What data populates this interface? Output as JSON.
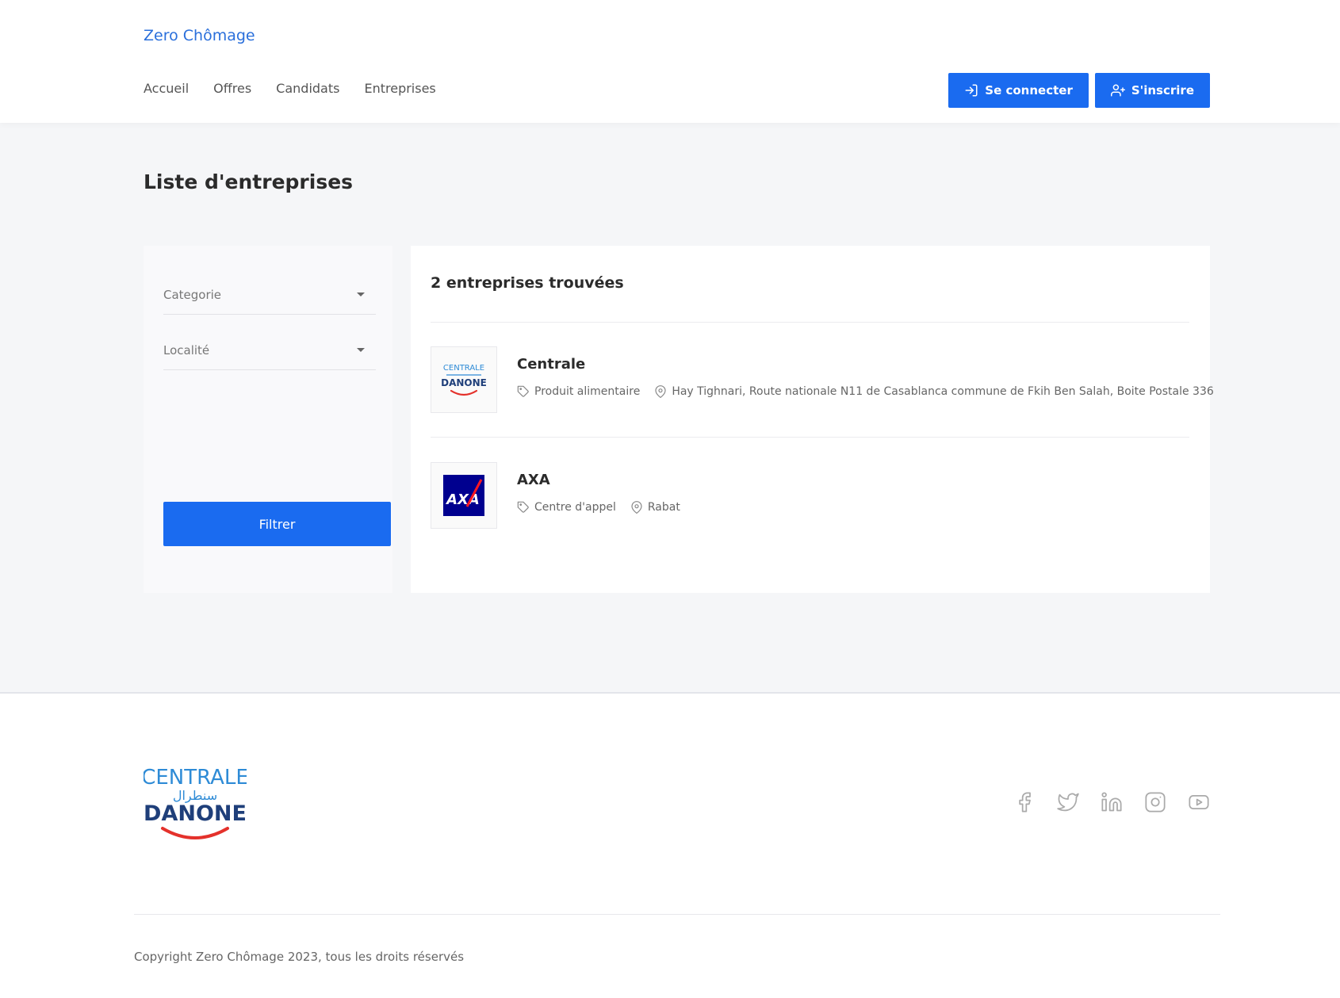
{
  "header": {
    "brand": "Zero Chômage",
    "nav": [
      "Accueil",
      "Offres",
      "Candidats",
      "Entreprises"
    ],
    "login_label": "Se connecter",
    "signup_label": "S'inscrire"
  },
  "main": {
    "title": "Liste d'entreprises",
    "filters": {
      "category_label": "Categorie",
      "locality_label": "Localité",
      "filter_button": "Filtrer"
    },
    "results": {
      "count_label": "2 entreprises trouvées",
      "companies": [
        {
          "name": "Centrale",
          "category": "Produit alimentaire",
          "address": "Hay Tighnari, Route nationale N11 de Casablanca commune de Fkih Ben Salah, Boite Postale 336",
          "logo_text_top": "CENTRALE",
          "logo_text_bottom": "DANONE"
        },
        {
          "name": "AXA",
          "category": "Centre d'appel",
          "address": "Rabat",
          "logo_text": "AXA"
        }
      ]
    }
  },
  "footer": {
    "logo_text_top": "CENTRALE",
    "logo_text_arabic": "سنطرال",
    "logo_text_bottom": "DANONE",
    "socials": [
      "facebook-icon",
      "twitter-icon",
      "linkedin-icon",
      "instagram-icon",
      "youtube-icon"
    ],
    "copyright": "Copyright Zero Chômage 2023, tous les droits réservés"
  },
  "colors": {
    "primary": "#1a6bf0",
    "brand_link": "#2a6fdb",
    "axa_blue": "#00008f",
    "axa_red": "#ff1721",
    "danone_blue": "#1f3f7a",
    "danone_light_blue": "#2e8bd6",
    "danone_red": "#e4312b"
  }
}
